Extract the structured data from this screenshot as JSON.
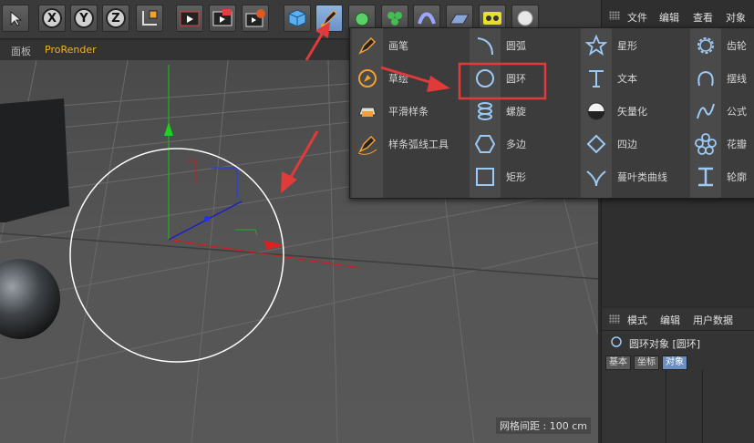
{
  "subbar": {
    "items": [
      "面板",
      "ProRender"
    ]
  },
  "toolbar": {
    "axis_x": "X",
    "axis_y": "Y",
    "axis_z": "Z"
  },
  "palette": {
    "col1": [
      "画笔",
      "草绘",
      "平滑样条",
      "样条弧线工具"
    ],
    "col2": [
      "圆弧",
      "圆环",
      "螺旋",
      "多边",
      "矩形"
    ],
    "col3": [
      "星形",
      "文本",
      "矢量化",
      "四边",
      "蔓叶类曲线"
    ],
    "col4": [
      "齿轮",
      "摆线",
      "公式",
      "花瓣",
      "轮廓"
    ]
  },
  "right_top_menu": [
    "文件",
    "编辑",
    "查看",
    "对象"
  ],
  "attributes": {
    "menu": [
      "模式",
      "编辑",
      "用户数据"
    ],
    "object_title": "圆环对象 [圆环]",
    "tabs": [
      "基本",
      "坐标",
      "对象"
    ]
  },
  "viewport": {
    "grid_spacing": "网格间距 : 100 cm"
  },
  "colors": {
    "highlight": "#e03a3a",
    "accent_tab": "#6b8fc0",
    "orange_label": "#f0b030"
  }
}
